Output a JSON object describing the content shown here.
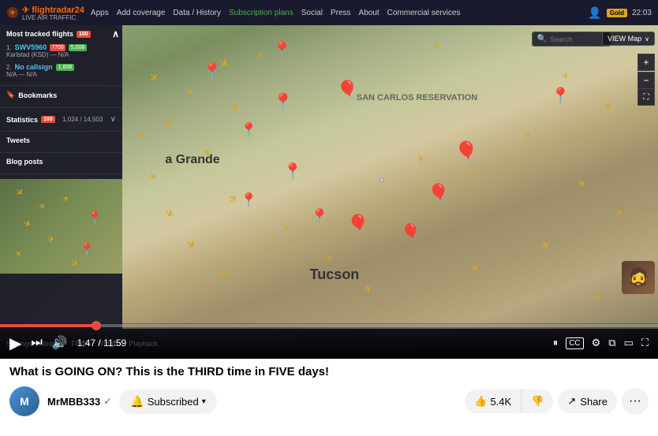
{
  "app": {
    "title": "What is GOING ON? This is the THIRD time in FIVE days!"
  },
  "navbar": {
    "logo": "✈ flightradar24",
    "logo_sub": "LIVE AIR TRAFFIC",
    "apps": "Apps",
    "add_coverage": "Add coverage",
    "data_history": "Data / History",
    "subscription": "Subscription plans",
    "social": "Social",
    "press": "Press",
    "about": "About",
    "commercial": "Commercial services",
    "user_badge": "Gold",
    "time": "22:03"
  },
  "sidebar": {
    "most_tracked_title": "Most tracked flights",
    "most_tracked_badge": "100",
    "flight1_num": "SWV5960",
    "flight1_alt": "7700",
    "flight1_count": "5,008",
    "flight1_route": "Karlstad (KSD) — N/A",
    "flight2_label": "No callsign",
    "flight2_count": "1,608",
    "flight2_route": "N/A — N/A",
    "bookmarks": "Bookmarks",
    "statistics_title": "Statistics",
    "statistics_badge": "100",
    "statistics_count": "1,024 / 14,503",
    "tweets": "Tweets",
    "blog_posts": "Blog posts"
  },
  "map": {
    "region_label": "SAN CARLOS\nRESERVATION",
    "city_tucson": "Tucson",
    "city_grande": "a Grande",
    "search_placeholder": "Search"
  },
  "controls": {
    "play_icon": "▶",
    "next_icon": "⏭",
    "volume_icon": "🔊",
    "time_current": "1:47",
    "time_total": "11:59",
    "time_separator": " / ",
    "pause_icon": "⏸",
    "cc_label": "CC",
    "settings_icon": "⚙",
    "miniplayer_icon": "⧉",
    "theatre_icon": "▭",
    "fullscreen_icon": "⛶"
  },
  "video": {
    "title": "What is GOING ON? This is the THIRD time in FIVE days!",
    "channel_name": "MrMBB333",
    "channel_verified": true,
    "subscribed_label": "Subscribed",
    "like_count": "5.4K",
    "share_label": "Share",
    "more_label": "···"
  },
  "bottom_bar": {
    "settings": "Settings",
    "weather": "Weather",
    "filters": "Filters",
    "widgets": "Widgets",
    "playback": "Playback"
  }
}
